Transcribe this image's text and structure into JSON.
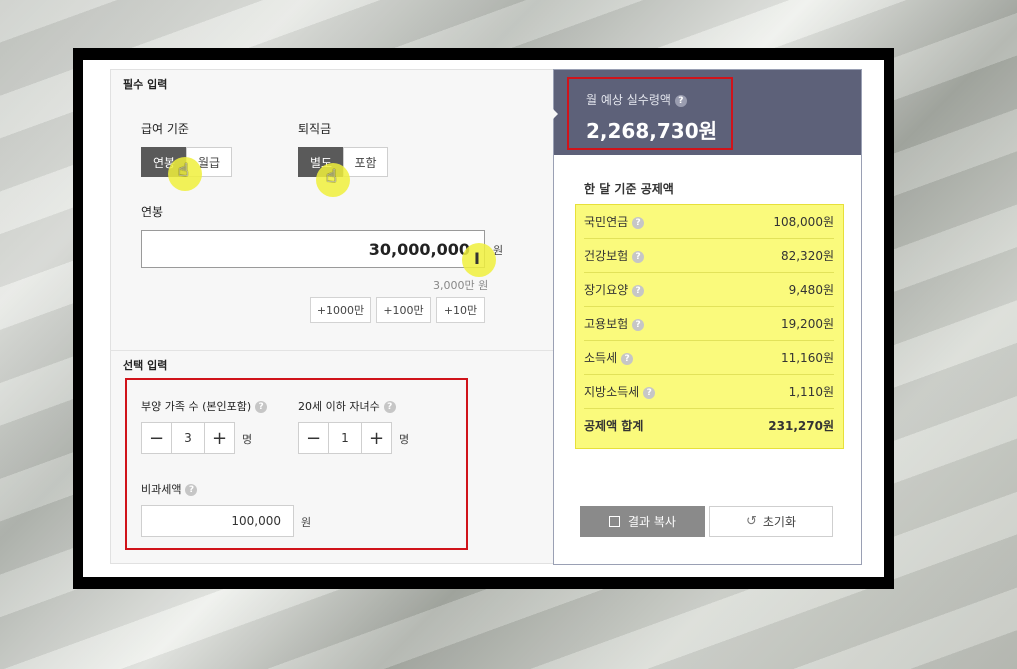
{
  "required": {
    "section_title": "필수 입력",
    "pay_basis": {
      "label": "급여 기준",
      "options": [
        "연봉",
        "월급"
      ],
      "selected": "연봉"
    },
    "severance": {
      "label": "퇴직금",
      "options": [
        "별도",
        "포함"
      ],
      "selected": "별도"
    },
    "salary": {
      "label": "연봉",
      "value": "30,000,000",
      "unit": "원",
      "helper": "3,000만 원"
    },
    "increments": [
      "+1000만",
      "+100만",
      "+10만"
    ]
  },
  "optional": {
    "section_title": "선택 입력",
    "dependents": {
      "label": "부양 가족 수 (본인포함)",
      "value": "3",
      "unit": "명"
    },
    "children": {
      "label": "20세 이하 자녀수",
      "value": "1",
      "unit": "명"
    },
    "nontaxable": {
      "label": "비과세액",
      "value": "100,000",
      "unit": "원"
    }
  },
  "result": {
    "title": "월 예상 실수령액",
    "amount": "2,268,730원",
    "deductions_title": "한 달 기준 공제액",
    "deductions": [
      {
        "name": "국민연금",
        "value": "108,000원"
      },
      {
        "name": "건강보험",
        "value": "82,320원"
      },
      {
        "name": "장기요양",
        "value": "9,480원"
      },
      {
        "name": "고용보험",
        "value": "19,200원"
      },
      {
        "name": "소득세",
        "value": "11,160원"
      },
      {
        "name": "지방소득세",
        "value": "1,110원"
      }
    ],
    "total": {
      "name": "공제액 합계",
      "value": "231,270원"
    },
    "copy_button": "결과 복사",
    "reset_button": "초기화"
  },
  "colors": {
    "header_bg": "#5d6179",
    "highlight_red": "#d0131a",
    "highlight_yellow": "#fafa7c",
    "active_segment": "#5a5a5a"
  },
  "icons": {
    "help": "?",
    "minus": "−",
    "plus": "+",
    "copy": "copy-icon",
    "reset": "refresh-icon"
  }
}
